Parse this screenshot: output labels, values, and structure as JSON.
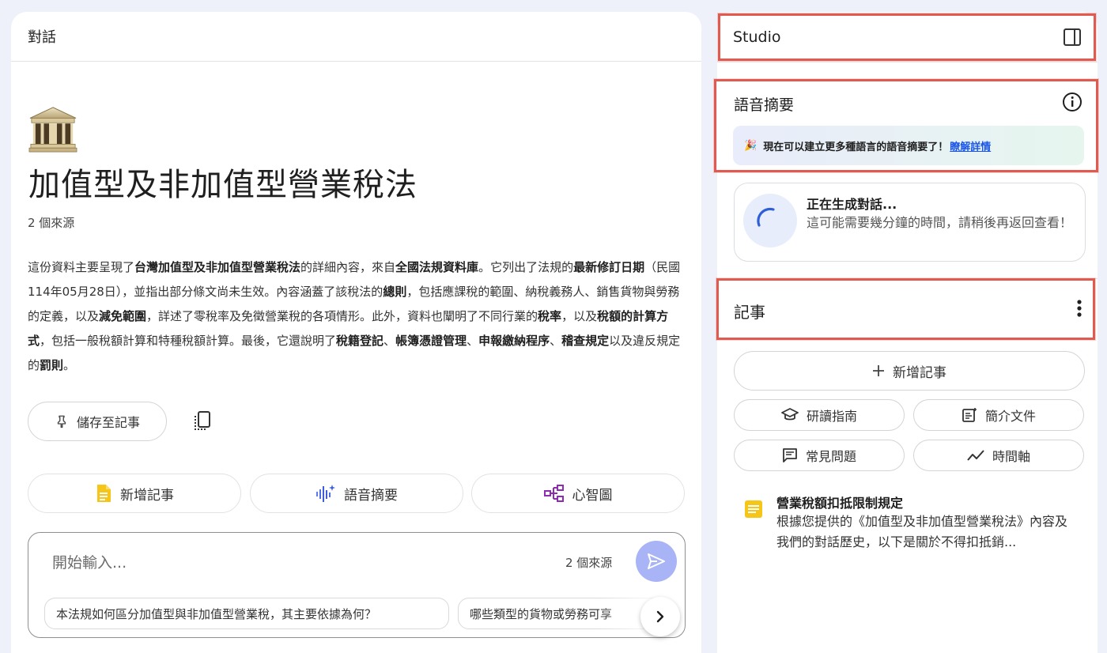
{
  "chat": {
    "header": "對話",
    "source_title": "加值型及非加值型營業稅法",
    "source_count": "2 個來源",
    "summary": [
      {
        "t": "這份資料主要呈現了",
        "b": false
      },
      {
        "t": "台灣加值型及非加值型營業稅法",
        "b": true
      },
      {
        "t": "的詳細內容，來自",
        "b": false
      },
      {
        "t": "全國法規資料庫",
        "b": true
      },
      {
        "t": "。它列出了法規的",
        "b": false
      },
      {
        "t": "最新修訂日期",
        "b": true
      },
      {
        "t": "（民國114年05月28日），並指出部分條文尚未生效。內容涵蓋了該稅法的",
        "b": false
      },
      {
        "t": "總則",
        "b": true
      },
      {
        "t": "，包括應課稅的範圍、納稅義務人、銷售貨物與勞務的定義，以及",
        "b": false
      },
      {
        "t": "減免範圍",
        "b": true
      },
      {
        "t": "，詳述了零稅率及免徵營業稅的各項情形。此外，資料也闡明了不同行業的",
        "b": false
      },
      {
        "t": "稅率",
        "b": true
      },
      {
        "t": "，以及",
        "b": false
      },
      {
        "t": "稅額的計算方式",
        "b": true
      },
      {
        "t": "，包括一般稅額計算和特種稅額計算。最後，它還說明了",
        "b": false
      },
      {
        "t": "稅籍登記",
        "b": true
      },
      {
        "t": "、",
        "b": false
      },
      {
        "t": "帳簿憑證管理",
        "b": true
      },
      {
        "t": "、",
        "b": false
      },
      {
        "t": "申報繳納程序",
        "b": true
      },
      {
        "t": "、",
        "b": false
      },
      {
        "t": "稽查規定",
        "b": true
      },
      {
        "t": "以及違反規定的",
        "b": false
      },
      {
        "t": "罰則",
        "b": true
      },
      {
        "t": "。",
        "b": false
      }
    ],
    "save_button": "儲存至記事",
    "actions": {
      "notes": "新增記事",
      "audio": "語音摘要",
      "mindmap": "心智圖"
    },
    "input": {
      "placeholder": "開始輸入...",
      "source_count": "2 個來源"
    },
    "suggestions": [
      "本法規如何區分加值型與非加值型營業稅，其主要依據為何？",
      "哪些類型的貨物或勞務可享"
    ]
  },
  "studio": {
    "title": "Studio",
    "audio_overview": {
      "title": "語音摘要",
      "banner_emoji": "🎉",
      "banner_text": "現在可以建立更多種語言的語音摘要了！",
      "banner_link": "瞭解詳情"
    },
    "generating": {
      "title": "正在生成對話...",
      "desc": "這可能需要幾分鐘的時間，請稍後再返回查看！"
    },
    "notes": {
      "title": "記事",
      "add_button": "新增記事",
      "tools": [
        "研讀指南",
        "簡介文件",
        "常見問題",
        "時間軸"
      ],
      "items": [
        {
          "title": "營業稅額扣抵限制規定",
          "body": "根據您提供的《加值型及非加值型營業稅法》內容及我們的對話歷史，以下是關於不得扣抵銷..."
        }
      ]
    }
  },
  "colors": {
    "accent": "#a9b4f7",
    "annotation_red": "#e05a4f",
    "link": "#1a55e8",
    "note_yellow": "#f5c518"
  }
}
